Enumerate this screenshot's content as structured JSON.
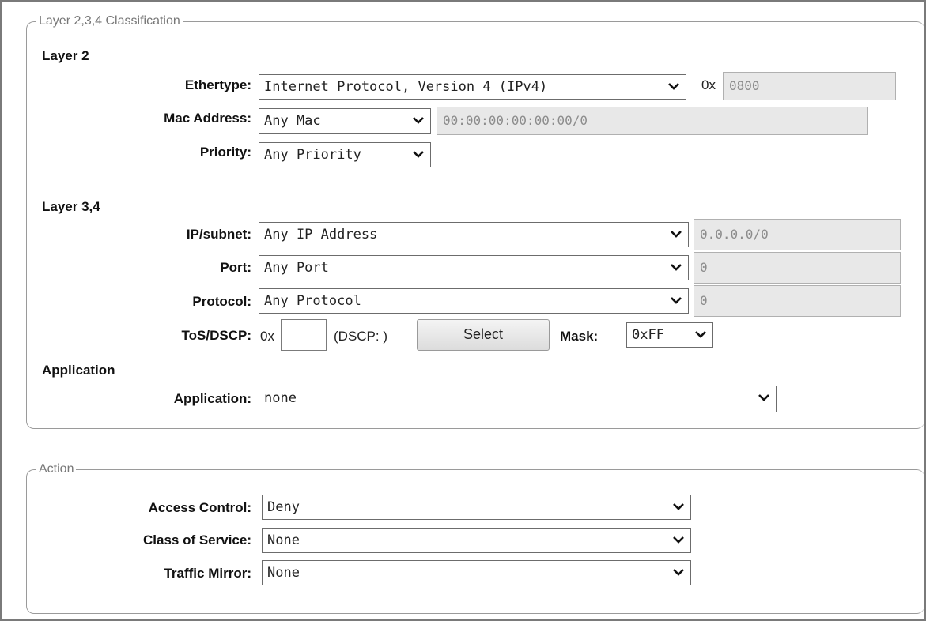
{
  "classification": {
    "legend": "Layer 2,3,4 Classification",
    "layer2": {
      "title": "Layer 2",
      "ethertype": {
        "label": "Ethertype:",
        "value": "Internet Protocol, Version 4 (IPv4)",
        "hex_prefix": "0x",
        "hex_value": "0800"
      },
      "mac": {
        "label": "Mac Address:",
        "value": "Any Mac",
        "field": "00:00:00:00:00:00/0"
      },
      "priority": {
        "label": "Priority:",
        "value": "Any Priority"
      }
    },
    "layer34": {
      "title": "Layer 3,4",
      "ip": {
        "label": "IP/subnet:",
        "value": "Any IP Address",
        "field": "0.0.0.0/0"
      },
      "port": {
        "label": "Port:",
        "value": "Any Port",
        "field": "0"
      },
      "protocol": {
        "label": "Protocol:",
        "value": "Any Protocol",
        "field": "0"
      },
      "tos": {
        "label": "ToS/DSCP:",
        "prefix": "0x",
        "value": "",
        "dscp_text": "(DSCP: )",
        "select_button": "Select",
        "mask_label": "Mask:",
        "mask_value": "0xFF"
      }
    },
    "application": {
      "title": "Application",
      "label": "Application:",
      "value": "none"
    }
  },
  "action": {
    "legend": "Action",
    "access_control": {
      "label": "Access Control:",
      "value": "Deny"
    },
    "class_of_service": {
      "label": "Class of Service:",
      "value": "None"
    },
    "traffic_mirror": {
      "label": "Traffic Mirror:",
      "value": "None"
    }
  },
  "icons": {
    "dropdown": "chevron-down-icon"
  }
}
